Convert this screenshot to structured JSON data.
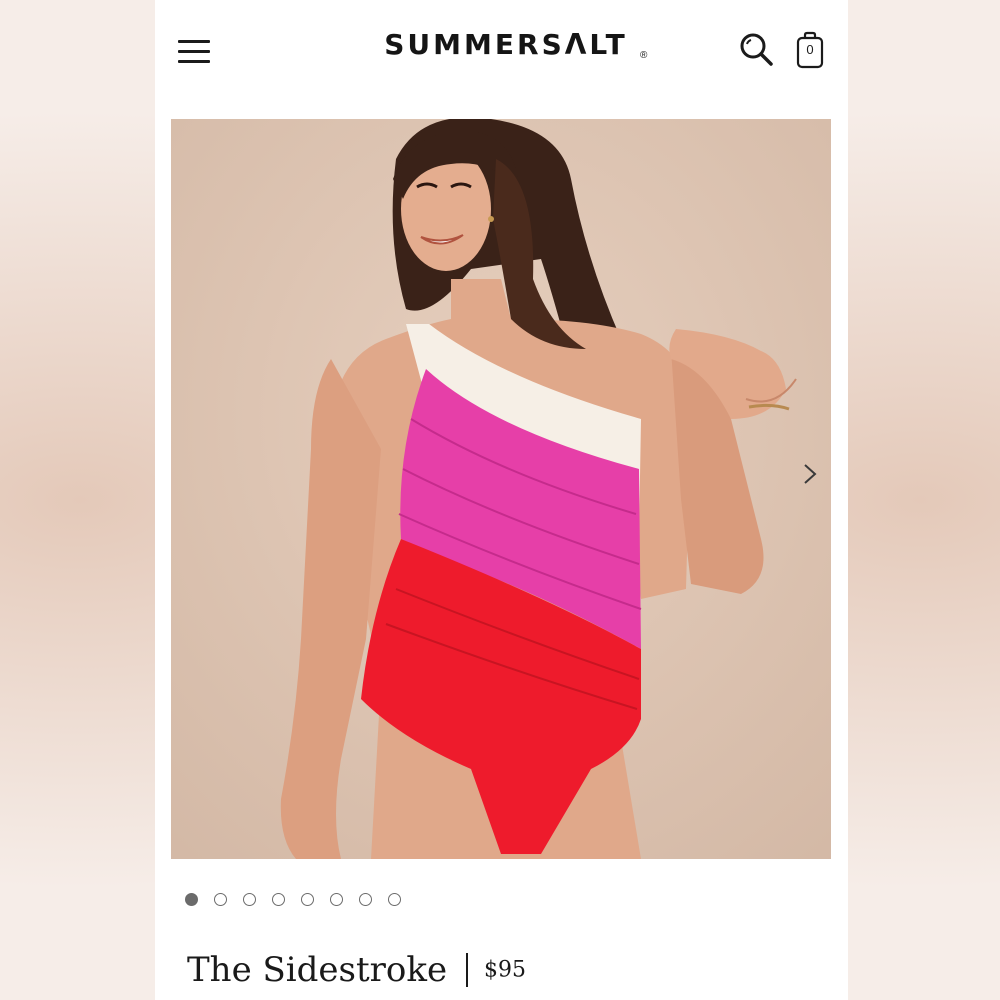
{
  "header": {
    "menu_icon": "hamburger-menu-icon",
    "logo_text": "SUMMERSΛLT",
    "logo_mark": "®",
    "search_icon": "search-icon",
    "cart_icon": "shopping-bag-icon",
    "cart_count": "0"
  },
  "gallery": {
    "image_alt": "Model wearing one-shoulder swimsuit with white, pink and red diagonal stripes",
    "next_icon": "chevron-right-icon",
    "total_images": 8,
    "active_index": 0
  },
  "product": {
    "name": "The Sidestroke",
    "price": "$95"
  },
  "colors": {
    "background": "#dcc4b2",
    "stripe_white": "#f6efe6",
    "stripe_pink": "#e63fa8",
    "stripe_red": "#ee1b2c"
  }
}
